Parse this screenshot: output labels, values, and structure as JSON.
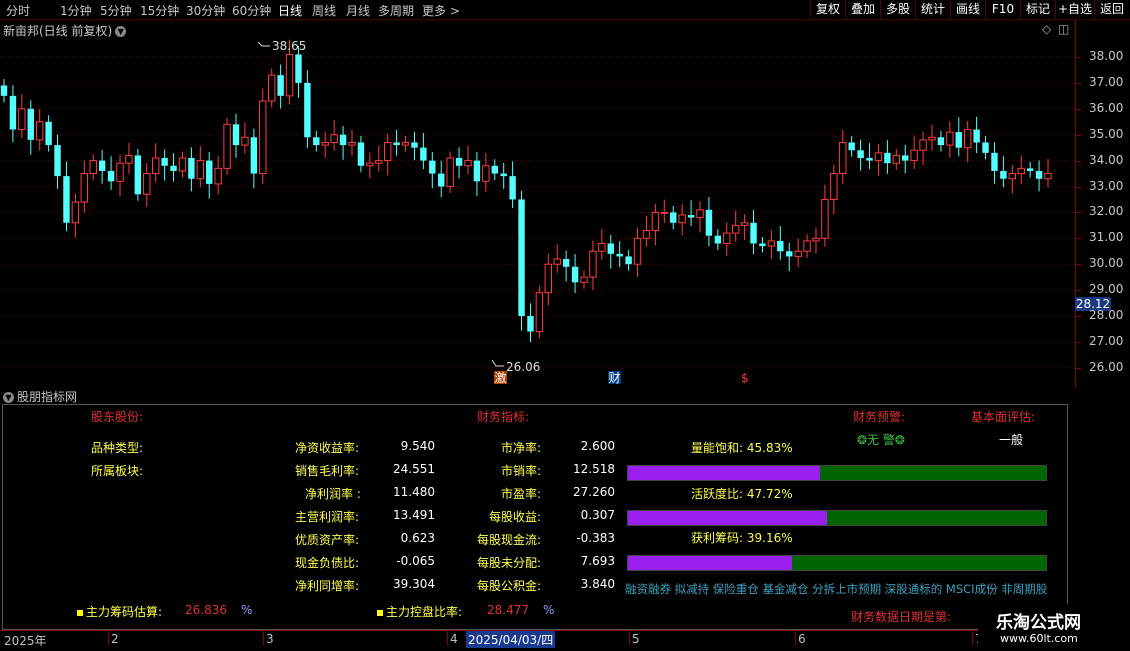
{
  "toolbar": {
    "periods": [
      "分时",
      "1分钟",
      "5分钟",
      "15分钟",
      "30分钟",
      "60分钟",
      "日线",
      "周线",
      "月线",
      "多周期",
      "更多"
    ],
    "active_period": "日线",
    "more_arrow": ">",
    "buttons": [
      "复权",
      "叠加",
      "多股",
      "统计",
      "画线",
      "F10",
      "标记",
      "+自选",
      "返回"
    ]
  },
  "chart": {
    "title": "新亩邦(日线 前复权)",
    "high_label": "38.65",
    "low_label": "26.06",
    "price_ticks": [
      "38.00",
      "37.00",
      "36.00",
      "35.00",
      "34.00",
      "33.00",
      "32.00",
      "31.00",
      "30.00",
      "29.00",
      "28.00",
      "27.00",
      "26.00"
    ],
    "current_price": "28.12",
    "markers": [
      "激",
      "财",
      "$"
    ],
    "colors": {
      "up": "#ff3c3c",
      "down": "#54ffff",
      "grid": "#6a0000",
      "axis": "#8a0000"
    }
  },
  "indicator": {
    "title": "股朋指标网",
    "headers": {
      "shareholder": "股东股份:",
      "finance": "财务指标:",
      "warning": "财务预警:",
      "evaluation": "基本面评估:"
    },
    "left_labels": [
      "品种类型:",
      "所属板块:"
    ],
    "metrics_left": [
      {
        "label": "净资收益率:",
        "value": "9.540"
      },
      {
        "label": "销售毛利率:",
        "value": "24.551"
      },
      {
        "label": "净利润率 :",
        "value": "11.480"
      },
      {
        "label": "主营利润率:",
        "value": "13.491"
      },
      {
        "label": "优质资产率:",
        "value": "0.623"
      },
      {
        "label": "现金负债比:",
        "value": "-0.065"
      },
      {
        "label": "净利同增率:",
        "value": "39.304"
      }
    ],
    "metrics_right": [
      {
        "label": "市净率:",
        "value": "2.600"
      },
      {
        "label": "市销率:",
        "value": "12.518"
      },
      {
        "label": "市盈率:",
        "value": "27.260"
      },
      {
        "label": "每股收益:",
        "value": "0.307"
      },
      {
        "label": "每股现金流:",
        "value": "-0.383"
      },
      {
        "label": "每股未分配:",
        "value": "7.693"
      },
      {
        "label": "每股公积金:",
        "value": "3.840"
      }
    ],
    "warning_value": "❂无 警❂",
    "evaluation_value": "一般",
    "bars": [
      {
        "label": "量能饱和:",
        "value": "45.83%",
        "fraction": 0.4583
      },
      {
        "label": "活跃度比:",
        "value": "47.72%",
        "fraction": 0.4772
      },
      {
        "label": "获利筹码:",
        "value": "39.16%",
        "fraction": 0.3916
      }
    ],
    "tags": "融资融券 拟减持 保险重仓 基金减仓 分拆上市预期 深股通标的 MSCI成份 非周期股",
    "bottom": {
      "main_chip_label": "主力筹码估算:",
      "main_chip_value": "26.836",
      "percent": "%",
      "control_label": "主力控盘比率:",
      "control_value": "28.477",
      "report_label": "财务数据日期是第:"
    }
  },
  "time_axis": {
    "labels": [
      "2025年",
      "2",
      "3",
      "4",
      "2025/04/03/四",
      "5",
      "6",
      "7"
    ]
  },
  "logo": {
    "name": "乐淘公式网",
    "url": "www.60lt.com"
  }
}
